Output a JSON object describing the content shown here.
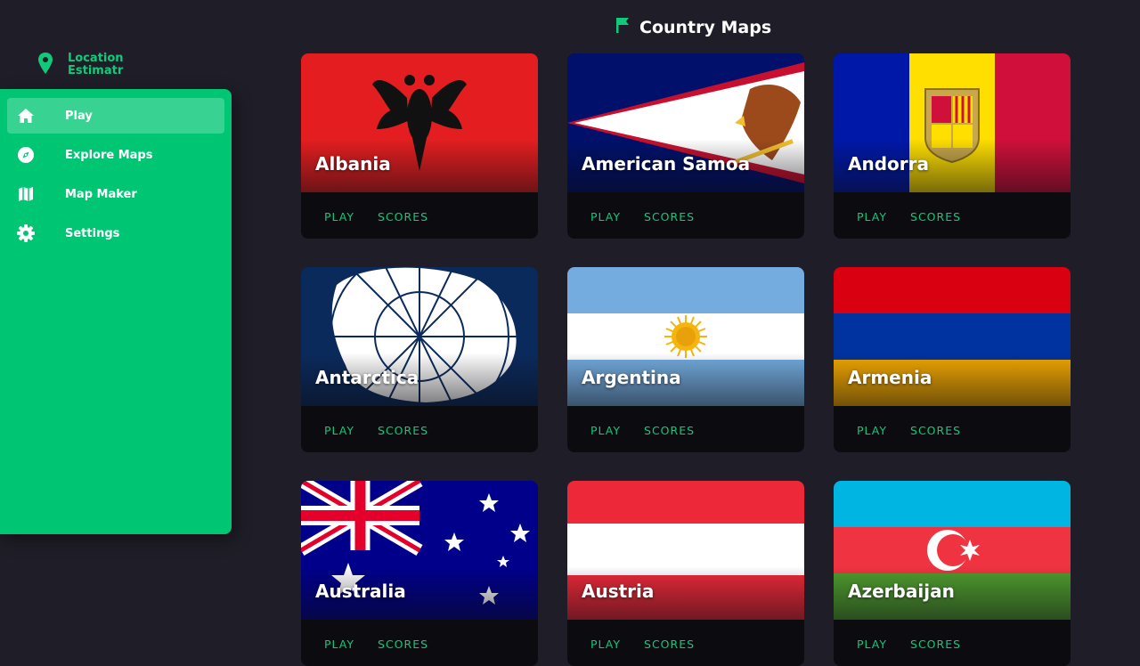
{
  "app": {
    "name": "Location Estimatr"
  },
  "sidebar": {
    "items": [
      {
        "label": "Play",
        "icon": "home-icon",
        "active": true
      },
      {
        "label": "Explore Maps",
        "icon": "compass-icon",
        "active": false
      },
      {
        "label": "Map Maker",
        "icon": "map-icon",
        "active": false
      },
      {
        "label": "Settings",
        "icon": "gear-icon",
        "active": false
      }
    ]
  },
  "header": {
    "title": "Country Maps",
    "icon": "flag-icon"
  },
  "cards": [
    {
      "country": "Albania",
      "play": "PLAY",
      "scores": "SCORES"
    },
    {
      "country": "American Samoa",
      "play": "PLAY",
      "scores": "SCORES"
    },
    {
      "country": "Andorra",
      "play": "PLAY",
      "scores": "SCORES"
    },
    {
      "country": "Antarctica",
      "play": "PLAY",
      "scores": "SCORES"
    },
    {
      "country": "Argentina",
      "play": "PLAY",
      "scores": "SCORES"
    },
    {
      "country": "Armenia",
      "play": "PLAY",
      "scores": "SCORES"
    },
    {
      "country": "Australia",
      "play": "PLAY",
      "scores": "SCORES"
    },
    {
      "country": "Austria",
      "play": "PLAY",
      "scores": "SCORES"
    },
    {
      "country": "Azerbaijan",
      "play": "PLAY",
      "scores": "SCORES"
    }
  ],
  "colors": {
    "accent": "#00c674",
    "accent_text": "#11c97a",
    "background": "#1f1e28",
    "card": "#0b0b10"
  }
}
